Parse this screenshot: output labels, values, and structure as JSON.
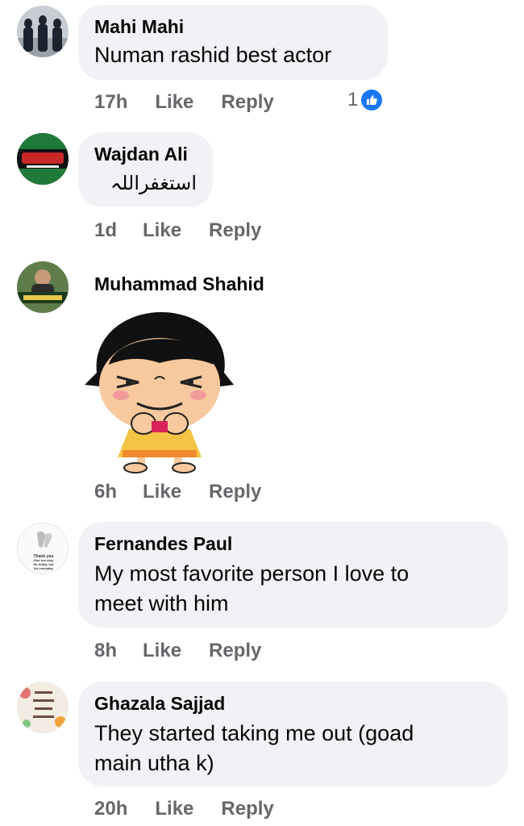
{
  "comments": [
    {
      "name": "Mahi Mahi",
      "text": "Numan rashid best actor",
      "time": "17h",
      "like": "Like",
      "reply": "Reply",
      "reaction_count": "1"
    },
    {
      "name": "Wajdan Ali",
      "text": "استغفراللہ",
      "time": "1d",
      "like": "Like",
      "reply": "Reply"
    },
    {
      "name": "Muhammad Shahid",
      "time": "6h",
      "like": "Like",
      "reply": "Reply",
      "sticker": "thumbs-up-girl-sticker"
    },
    {
      "name": "Fernandes Paul",
      "text_line1": "My most favorite person I love to",
      "text_line2": "meet with him",
      "time": "8h",
      "like": "Like",
      "reply": "Reply",
      "avatar_text": [
        "Thank you",
        "God not only",
        "for today, but",
        "for everyday"
      ]
    },
    {
      "name": "Ghazala Sajjad",
      "text_line1": "They started taking me out (goad",
      "text_line2": "main utha k)",
      "time": "20h",
      "like": "Like",
      "reply": "Reply"
    }
  ],
  "icons": {
    "reaction": "like-thumb-icon"
  },
  "colors": {
    "bubble": "#f0f2f5",
    "meta": "#65676b",
    "like_blue": "#1877f2"
  }
}
